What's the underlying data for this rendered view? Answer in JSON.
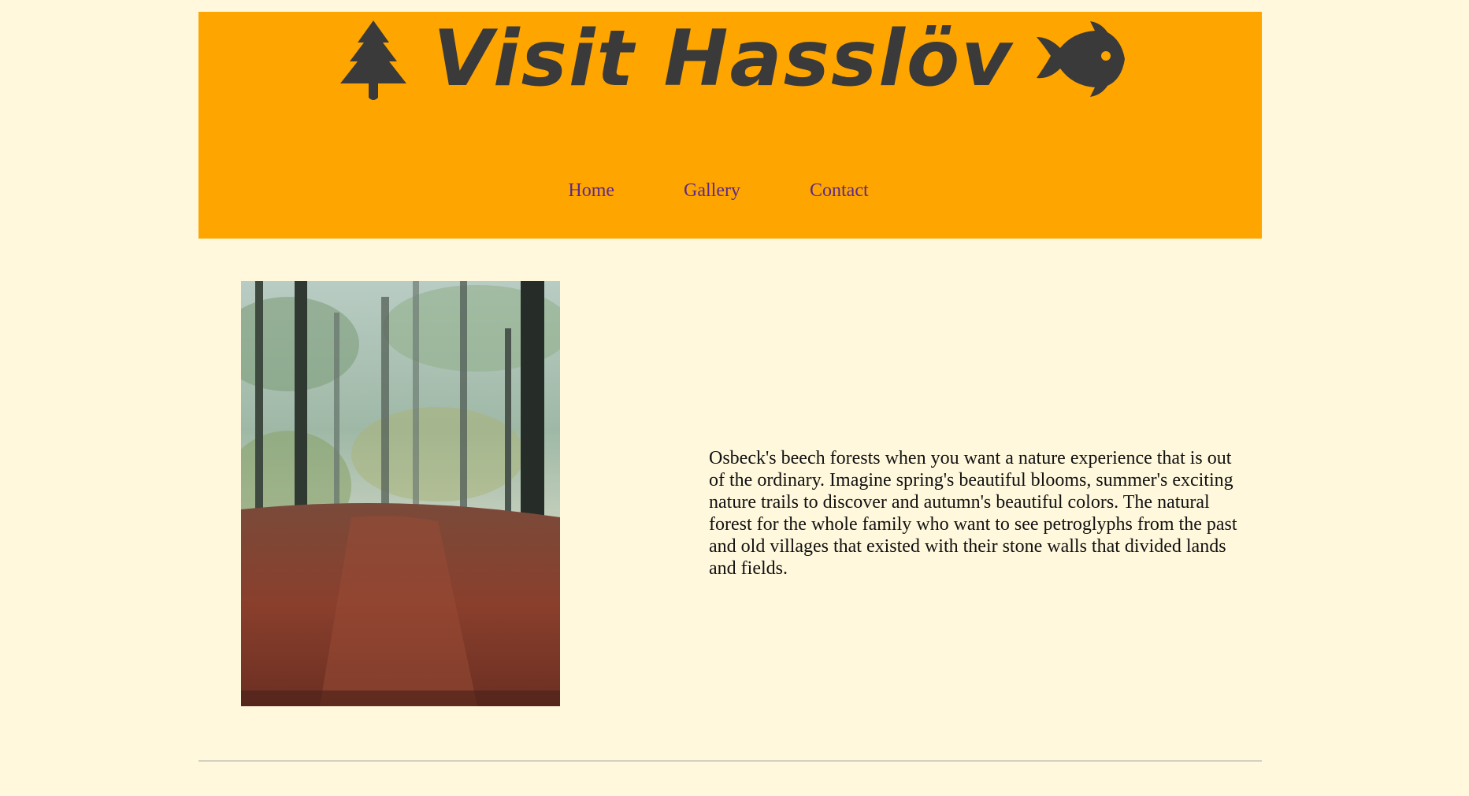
{
  "header": {
    "title": "Visit Hasslöv",
    "left_icon": "pine-tree-icon",
    "right_icon": "fish-icon",
    "background": "#ffa500",
    "title_color": "#3a3a3a"
  },
  "nav": {
    "items": [
      {
        "label": "Home"
      },
      {
        "label": "Gallery"
      },
      {
        "label": "Contact"
      }
    ],
    "link_color": "#5b2a8a"
  },
  "main": {
    "image_alt": "forest path covered in autumn leaves",
    "description": "Osbeck's beech forests when you want a nature experience that is out of the ordinary. Imagine spring's beautiful blooms, summer's exciting nature trails to discover and autumn's beautiful colors. The natural forest for the whole family who want to see petroglyphs from the past and old villages that existed with their stone walls that divided lands and fields."
  },
  "page_background": "#fff8dc"
}
